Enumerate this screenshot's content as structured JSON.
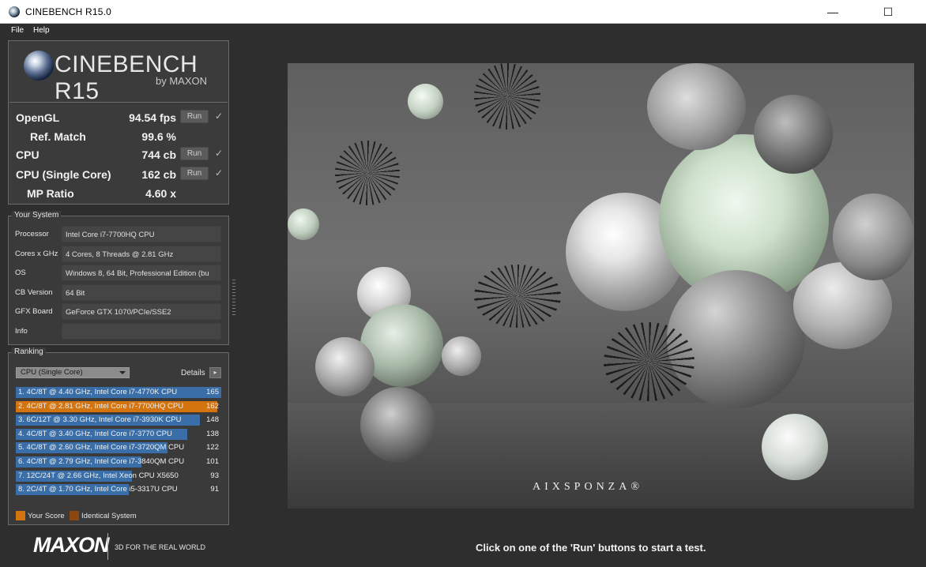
{
  "window": {
    "title": "CINEBENCH R15.0",
    "minimize": "—",
    "maximize": "☐"
  },
  "menu": {
    "file": "File",
    "help": "Help"
  },
  "logo": {
    "name": "CINEBENCH R15",
    "by": "by MAXON"
  },
  "scores": {
    "opengl": {
      "label": "OpenGL",
      "value": "94.54 fps",
      "run": "Run",
      "check": "✓"
    },
    "refmatch": {
      "label": "Ref. Match",
      "value": "99.6 %"
    },
    "cpu": {
      "label": "CPU",
      "value": "744 cb",
      "run": "Run",
      "check": "✓"
    },
    "cpu_single": {
      "label": "CPU (Single Core)",
      "value": "162 cb",
      "run": "Run",
      "check": "✓"
    },
    "mp_ratio": {
      "label": "MP Ratio",
      "value": "4.60 x"
    }
  },
  "system": {
    "title": "Your System",
    "rows": [
      {
        "label": "Processor",
        "value": "Intel Core i7-7700HQ CPU"
      },
      {
        "label": "Cores x GHz",
        "value": "4 Cores, 8 Threads @ 2.81 GHz"
      },
      {
        "label": "OS",
        "value": "Windows 8, 64 Bit, Professional Edition (bu"
      },
      {
        "label": "CB Version",
        "value": "64 Bit"
      },
      {
        "label": "GFX Board",
        "value": "GeForce GTX 1070/PCIe/SSE2"
      },
      {
        "label": "Info",
        "value": ""
      }
    ]
  },
  "ranking": {
    "title": "Ranking",
    "selected": "CPU (Single Core)",
    "details": "Details",
    "details_arrow": "▸",
    "max_score": 165,
    "colors": {
      "blue": "#3a6ea8",
      "orange": "#d3740f",
      "brown": "#8a4712"
    },
    "items": [
      {
        "text": "1. 4C/8T @ 4.40 GHz, Intel Core i7-4770K CPU",
        "score": 165,
        "highlight": false
      },
      {
        "text": "2. 4C/8T @ 2.81 GHz, Intel Core i7-7700HQ CPU",
        "score": 162,
        "highlight": true
      },
      {
        "text": "3. 6C/12T @ 3.30 GHz,  Intel Core i7-3930K CPU",
        "score": 148,
        "highlight": false
      },
      {
        "text": "4. 4C/8T @ 3.40 GHz,  Intel Core i7-3770 CPU",
        "score": 138,
        "highlight": false
      },
      {
        "text": "5. 4C/8T @ 2.60 GHz, Intel Core i7-3720QM CPU",
        "score": 122,
        "highlight": false
      },
      {
        "text": "6. 4C/8T @ 2.79 GHz,  Intel Core i7-3840QM CPU",
        "score": 101,
        "highlight": false
      },
      {
        "text": "7. 12C/24T @ 2.66 GHz, Intel Xeon CPU X5650",
        "score": 93,
        "highlight": false
      },
      {
        "text": "8. 2C/4T @ 1.70 GHz,  Intel Core i5-3317U CPU",
        "score": 91,
        "highlight": false
      }
    ],
    "legend": {
      "your_score": "Your Score",
      "identical": "Identical System"
    }
  },
  "footer": {
    "brand": "MAXON",
    "tagline": "3D FOR THE REAL WORLD",
    "status": "Click on one of the 'Run' buttons to start a test."
  },
  "render": {
    "watermark": "AIXSPONZA®"
  }
}
